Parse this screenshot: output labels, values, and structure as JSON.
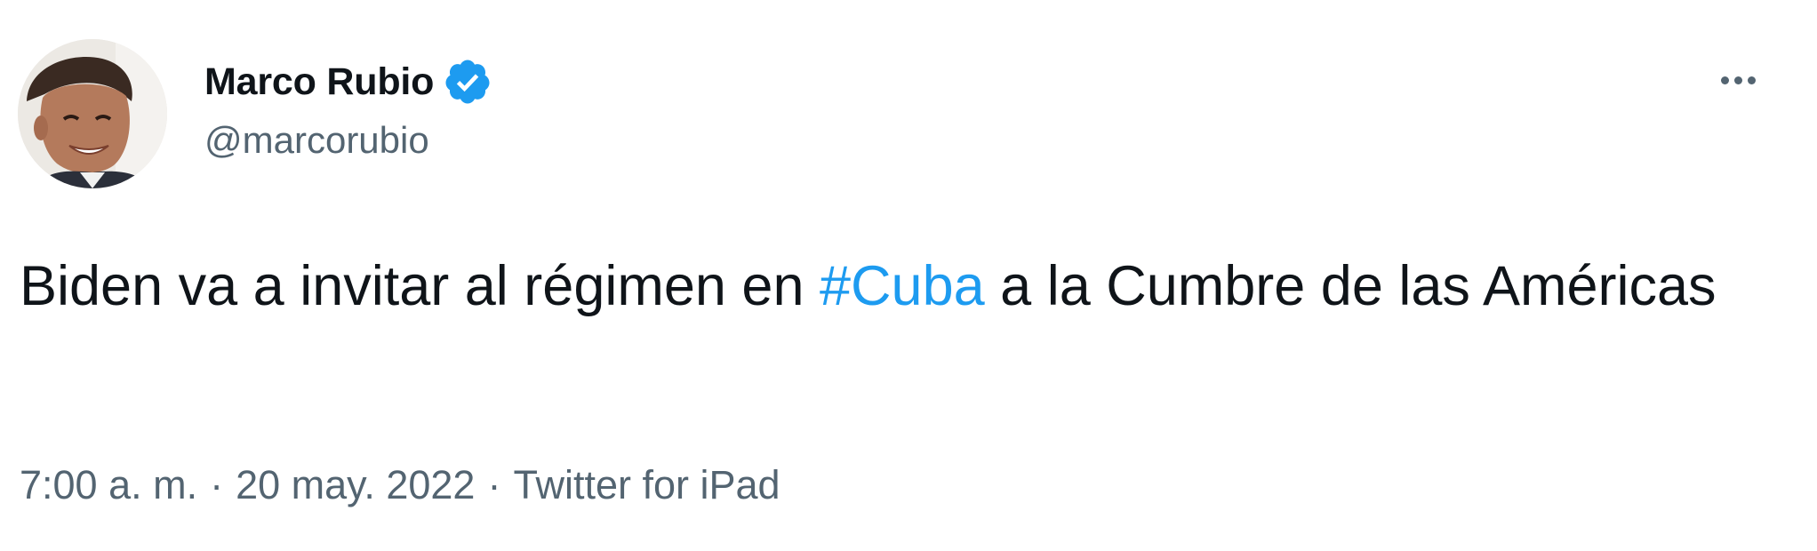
{
  "author": {
    "name": "Marco Rubio",
    "handle": "@marcorubio",
    "verified": true
  },
  "tweet": {
    "text_before_hashtag": "Biden va a invitar al régimen en ",
    "hashtag": "#Cuba",
    "text_after_hashtag": " a la Cumbre de las Américas"
  },
  "meta": {
    "time": "7:00 a. m.",
    "separator": "·",
    "date": "20 may. 2022",
    "source": "Twitter for iPad"
  },
  "icons": {
    "verified": "verified-badge-icon",
    "more": "more-horizontal-icon"
  },
  "colors": {
    "link": "#1d9bf0",
    "secondary_text": "#536471",
    "primary_text": "#0f1419",
    "verified_badge": "#1d9bf0"
  }
}
